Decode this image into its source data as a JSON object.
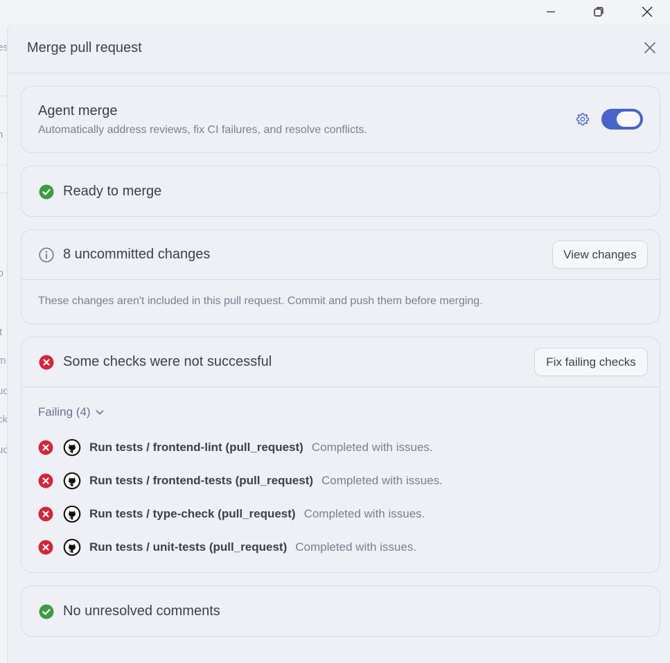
{
  "window": {
    "minimize_icon": "minimize-icon",
    "restore_icon": "restore-icon",
    "close_icon": "close-icon"
  },
  "background_fragments": [
    "es",
    "h",
    "lib",
    "-t",
    "m",
    "uc",
    "ck",
    "uc"
  ],
  "modal": {
    "title": "Merge pull request",
    "close_icon": "close-icon"
  },
  "agent_merge": {
    "title": "Agent merge",
    "description": "Automatically address reviews, fix CI failures, and resolve conflicts.",
    "settings_icon": "gear-icon",
    "toggle_on": true
  },
  "ready": {
    "label": "Ready to merge",
    "icon": "check-circle-icon"
  },
  "uncommitted": {
    "title": "8 uncommitted changes",
    "icon": "info-icon",
    "button": "View changes",
    "note": "These changes aren't included in this pull request. Commit and push them before merging."
  },
  "checks": {
    "title": "Some checks were not successful",
    "icon": "x-circle-icon",
    "button": "Fix failing checks",
    "failing_label": "Failing (4)",
    "items": [
      {
        "name": "Run tests / frontend-lint (pull_request)",
        "status": "Completed with issues."
      },
      {
        "name": "Run tests / frontend-tests (pull_request)",
        "status": "Completed with issues."
      },
      {
        "name": "Run tests / type-check (pull_request)",
        "status": "Completed with issues."
      },
      {
        "name": "Run tests / unit-tests (pull_request)",
        "status": "Completed with issues."
      }
    ]
  },
  "comments": {
    "label": "No unresolved comments",
    "icon": "check-circle-icon"
  },
  "colors": {
    "accent": "#4a63c8",
    "success": "#3d9a46",
    "error": "#d0273b"
  }
}
